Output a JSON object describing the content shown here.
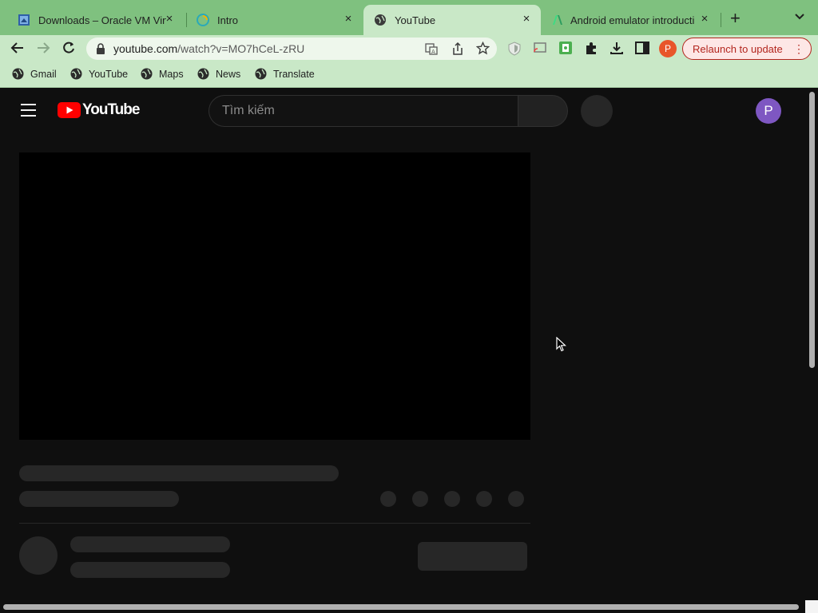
{
  "tabs": [
    {
      "title": "Downloads – Oracle VM Virt",
      "close": "×"
    },
    {
      "title": "Intro",
      "close": "×"
    },
    {
      "title": "YouTube",
      "close": "×"
    },
    {
      "title": "Android emulator introducti",
      "close": "×"
    }
  ],
  "new_tab": "+",
  "tab_menu": "⌄",
  "omnibox": {
    "host": "youtube.com",
    "path": "/watch?v=MO7hCeL-zRU"
  },
  "profile_initial": "P",
  "relaunch": {
    "label": "Relaunch to update",
    "menu": "⋮"
  },
  "bookmarks": [
    "Gmail",
    "YouTube",
    "Maps",
    "News",
    "Translate"
  ],
  "youtube": {
    "brand": "YouTube",
    "search_placeholder": "Tìm kiếm",
    "avatar_initial": "P"
  },
  "colors": {
    "accent_red": "#ff0000",
    "tabbar": "#7fc17f",
    "toolbar": "#c9e8c7",
    "yt_bg": "#0f0f0f",
    "avatar": "#7e57c2"
  }
}
